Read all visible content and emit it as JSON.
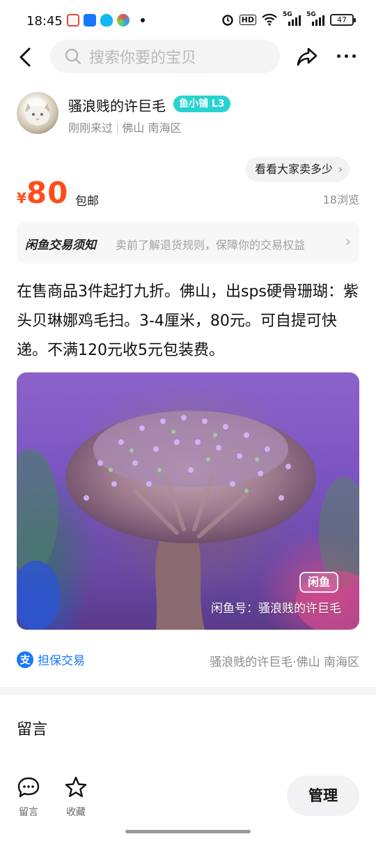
{
  "status_bar": {
    "time": "18:45",
    "battery": "47",
    "hd_label": "HD",
    "network_1": "5G",
    "network_2": "5G"
  },
  "nav": {
    "search_placeholder": "搜索你要的宝贝"
  },
  "seller": {
    "name": "骚浪贱的许巨毛",
    "badge": "鱼小铺 L3",
    "last_seen": "刚刚来过",
    "location": "佛山 南海区"
  },
  "price": {
    "currency": "¥",
    "amount": "80",
    "shipping": "包邮",
    "views": "18浏览",
    "compare_button": "看看大家卖多少"
  },
  "notice": {
    "title": "闲鱼交易须知",
    "text": "卖前了解退货规则，保障你的交易权益"
  },
  "description": "在售商品3件起打九折。佛山，出sps硬骨珊瑚：紫头贝琳娜鸡毛扫。3-4厘米，80元。可自提可快递。不满120元收5元包装费。",
  "image": {
    "watermark_logo": "闲鱼",
    "watermark_text": "闲鱼号：骚浪贱的许巨毛"
  },
  "guarantee": {
    "icon_text": "支",
    "label": "担保交易",
    "seller_location": "骚浪贱的许巨毛·佛山 南海区"
  },
  "comments": {
    "title": "留言"
  },
  "bottom_bar": {
    "comment_label": "留言",
    "favorite_label": "收藏",
    "manage_label": "管理"
  },
  "colors": {
    "price": "#ff4d1a",
    "badge": "#27d3d0",
    "alipay_blue": "#1677ff"
  },
  "icons": [
    "back-icon",
    "search-icon",
    "share-icon",
    "more-icon",
    "comment-icon",
    "star-icon",
    "alipay-icon"
  ]
}
